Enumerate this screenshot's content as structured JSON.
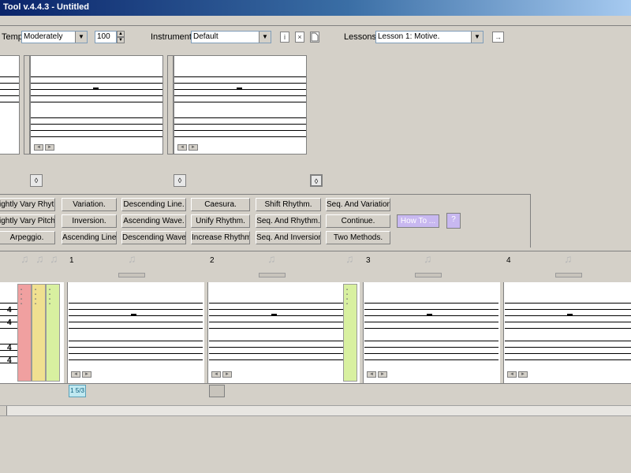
{
  "window": {
    "title": "Tool v.4.4.3 - Untitled"
  },
  "toolbar": {
    "temp_label": "Temp:",
    "temp_value": "Moderately",
    "tempo_value": "100",
    "instruments_label": "Instruments:",
    "instruments_value": "Default",
    "info_glyph": "i",
    "close_glyph": "×",
    "lessons_label": "Lessons:",
    "lessons_value": "Lesson 1: Motive.",
    "go_glyph": "→"
  },
  "patterns": {
    "col1": [
      "ightly Vary Rhythm.",
      "ightly Vary Pitch.",
      "Arpeggio."
    ],
    "col2": [
      "Variation.",
      "Inversion.",
      "Ascending Line."
    ],
    "col3": [
      "Descending Line.",
      "Ascending Wave.",
      "Descending Wave."
    ],
    "col4": [
      "Caesura.",
      "Unify Rhythm.",
      "Increase Rhythm"
    ],
    "col5": [
      "Shift Rhythm.",
      "Seq. And Rhythm.",
      "Seq. And Inversion."
    ],
    "col6": [
      "Seq. And Variation.",
      "Continue.",
      "Two Methods."
    ],
    "how_to": "How To ...",
    "help_glyph": "?"
  },
  "measures": [
    {
      "number": "1"
    },
    {
      "number": "2"
    },
    {
      "number": "3"
    },
    {
      "number": "4"
    }
  ],
  "timesig": {
    "t1": "4",
    "t2": "4",
    "t3": "4",
    "t4": "4"
  },
  "position_indicator": "1 5/3",
  "colors": {
    "red": "#f0a0a0",
    "yellow": "#f0e090",
    "green": "#d8f0a0",
    "howto": "#c8b8f0"
  }
}
